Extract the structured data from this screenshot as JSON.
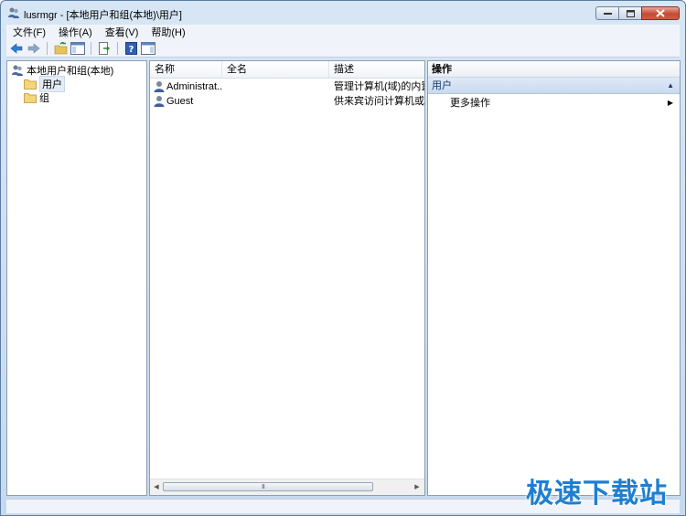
{
  "window": {
    "title": "lusrmgr - [本地用户和组(本地)\\用户]"
  },
  "menubar": {
    "items": [
      "文件(F)",
      "操作(A)",
      "查看(V)",
      "帮助(H)"
    ]
  },
  "tree": {
    "root": "本地用户和组(本地)",
    "children": [
      "用户",
      "组"
    ],
    "selected": "用户"
  },
  "list": {
    "columns": [
      "名称",
      "全名",
      "描述"
    ],
    "rows": [
      {
        "name": "Administrat...",
        "fullname": "",
        "description": "管理计算机(域)的内置帐"
      },
      {
        "name": "Guest",
        "fullname": "",
        "description": "供来宾访问计算机或访问"
      }
    ],
    "scroll_grip": "III"
  },
  "actions": {
    "title": "操作",
    "section": "用户",
    "items": [
      "更多操作"
    ]
  },
  "watermark": "极速下载站",
  "colors": {
    "selection": "#e4ecf7",
    "section_header": "#c9daf0",
    "watermark": "#1e7fd0"
  },
  "icons": {
    "app": "users-group-icon",
    "back": "back-arrow-icon",
    "forward": "forward-arrow-icon",
    "folder": "folder-icon",
    "user": "user-icon"
  }
}
